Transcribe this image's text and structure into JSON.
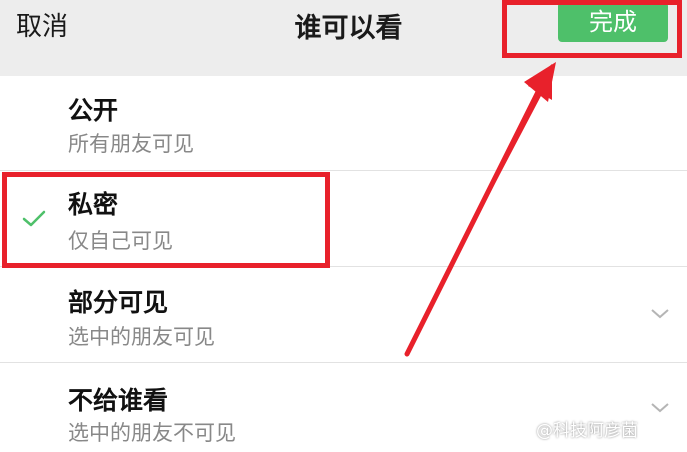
{
  "header": {
    "cancel_label": "取消",
    "title": "谁可以看",
    "done_label": "完成"
  },
  "options": [
    {
      "title": "公开",
      "subtitle": "所有朋友可见",
      "selected": false,
      "expandable": false
    },
    {
      "title": "私密",
      "subtitle": "仅自己可见",
      "selected": true,
      "expandable": false
    },
    {
      "title": "部分可见",
      "subtitle": "选中的朋友可见",
      "selected": false,
      "expandable": true
    },
    {
      "title": "不给谁看",
      "subtitle": "选中的朋友不可见",
      "selected": false,
      "expandable": true
    }
  ],
  "watermark": "@科技阿彦菌",
  "colors": {
    "accent": "#4ec06a",
    "annotation": "#e8212b",
    "header_bg": "#ededed",
    "check": "#4ec06a"
  },
  "icons": {
    "check": "check-icon",
    "chevron": "chevron-down-icon"
  }
}
